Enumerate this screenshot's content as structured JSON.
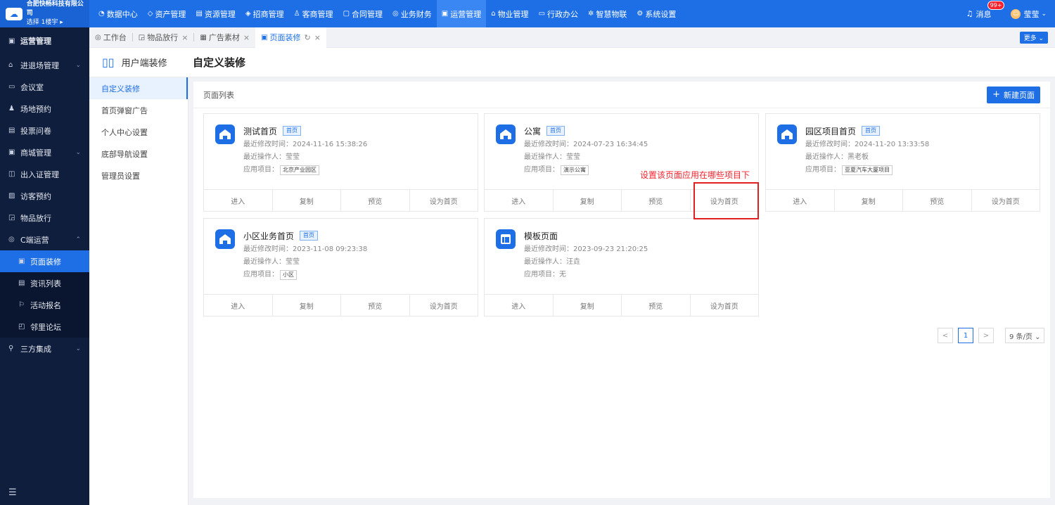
{
  "brand": {
    "company": "合肥快畅科技有限公司",
    "floor": "选择 1楼宇 ▸",
    "logo_icon": "cloud-logo-icon"
  },
  "topnav": [
    {
      "label": "数据中心",
      "icon": "◔",
      "active": false
    },
    {
      "label": "资产管理",
      "icon": "◇",
      "active": false
    },
    {
      "label": "资源管理",
      "icon": "▤",
      "active": false
    },
    {
      "label": "招商管理",
      "icon": "◈",
      "active": false
    },
    {
      "label": "客商管理",
      "icon": "♙",
      "active": false
    },
    {
      "label": "合同管理",
      "icon": "▢",
      "active": false
    },
    {
      "label": "业务财务",
      "icon": "◎",
      "active": false
    },
    {
      "label": "运营管理",
      "icon": "▣",
      "active": true
    },
    {
      "label": "物业管理",
      "icon": "⌂",
      "active": false
    },
    {
      "label": "行政办公",
      "icon": "▭",
      "active": false
    },
    {
      "label": "智慧物联",
      "icon": "✲",
      "active": false
    },
    {
      "label": "系统设置",
      "icon": "⚙",
      "active": false
    }
  ],
  "topright": {
    "msg_label": "消息",
    "msg_badge": "99+",
    "user_name": "莹莹"
  },
  "sidebar": {
    "title": "运营管理",
    "items": [
      {
        "label": "进退场管理",
        "icon": "⌂",
        "chev": "⌄"
      },
      {
        "label": "会议室",
        "icon": "▭",
        "chev": ""
      },
      {
        "label": "场地预约",
        "icon": "♟",
        "chev": ""
      },
      {
        "label": "投票问卷",
        "icon": "▤",
        "chev": ""
      },
      {
        "label": "商城管理",
        "icon": "▣",
        "chev": "⌄"
      },
      {
        "label": "出入证管理",
        "icon": "◫",
        "chev": ""
      },
      {
        "label": "访客预约",
        "icon": "▨",
        "chev": ""
      },
      {
        "label": "物品放行",
        "icon": "◲",
        "chev": ""
      },
      {
        "label": "C端运营",
        "icon": "◎",
        "chev": "⌃"
      }
    ],
    "subitems": [
      {
        "label": "页面装修",
        "icon": "▣",
        "active": true
      },
      {
        "label": "资讯列表",
        "icon": "▤",
        "active": false
      },
      {
        "label": "活动报名",
        "icon": "⚐",
        "active": false
      },
      {
        "label": "邻里论坛",
        "icon": "◰",
        "active": false
      }
    ],
    "after": {
      "label": "三方集成",
      "icon": "⚲",
      "chev": "⌄"
    },
    "bottom_icon": "☰"
  },
  "tabs": [
    {
      "label": "工作台",
      "icon": "◎",
      "close": false,
      "active": false
    },
    {
      "label": "物品放行",
      "icon": "◲",
      "close": true,
      "active": false
    },
    {
      "label": "广告素材",
      "icon": "▦",
      "close": true,
      "active": false
    },
    {
      "label": "页面装修",
      "icon": "▣",
      "close": true,
      "active": true
    }
  ],
  "more_label": "更多 ⌄",
  "subheader": {
    "module": "用户端装修",
    "title": "自定义装修"
  },
  "leftmenu": [
    {
      "label": "自定义装修",
      "active": true
    },
    {
      "label": "首页弹窗广告",
      "active": false
    },
    {
      "label": "个人中心设置",
      "active": false
    },
    {
      "label": "底部导航设置",
      "active": false
    },
    {
      "label": "管理员设置",
      "active": false
    }
  ],
  "main": {
    "list_label": "页面列表",
    "new_button": "新建页面"
  },
  "labels": {
    "modified": "最近修改时间：",
    "operator": "最近操作人：",
    "project": "应用项目："
  },
  "cards": [
    {
      "name": "测试首页",
      "tag": "首页",
      "modified": "2024-11-16 15:38:26",
      "operator": "莹莹",
      "project": "北京产业园区",
      "project_boxed": true,
      "icon": "home-icon"
    },
    {
      "name": "公寓",
      "tag": "首页",
      "modified": "2024-07-23 16:34:45",
      "operator": "莹莹",
      "project": "演示公寓",
      "project_boxed": true,
      "icon": "home-icon"
    },
    {
      "name": "园区项目首页",
      "tag": "首页",
      "modified": "2024-11-20 13:33:58",
      "operator": "黑老板",
      "project": "亚夏汽车大厦项目",
      "project_boxed": true,
      "icon": "home-icon"
    },
    {
      "name": "小区业务首页",
      "tag": "首页",
      "modified": "2023-11-08 09:23:38",
      "operator": "莹莹",
      "project": "小区",
      "project_boxed": true,
      "icon": "home-icon"
    },
    {
      "name": "模板页面",
      "tag": "",
      "modified": "2023-09-23 21:20:25",
      "operator": "汪垚",
      "project": "无",
      "project_boxed": false,
      "icon": "layout-icon"
    }
  ],
  "card_actions": [
    "进入",
    "复制",
    "预览",
    "设为首页"
  ],
  "annotation": "设置该页面应用在哪些项目下",
  "pager": {
    "prev": "<",
    "current": "1",
    "next": ">",
    "size": "9 条/页 ⌄"
  },
  "colors": {
    "primary": "#1e6fe6",
    "sidebar": "#0f1e3d",
    "annotation": "#f5222d"
  }
}
